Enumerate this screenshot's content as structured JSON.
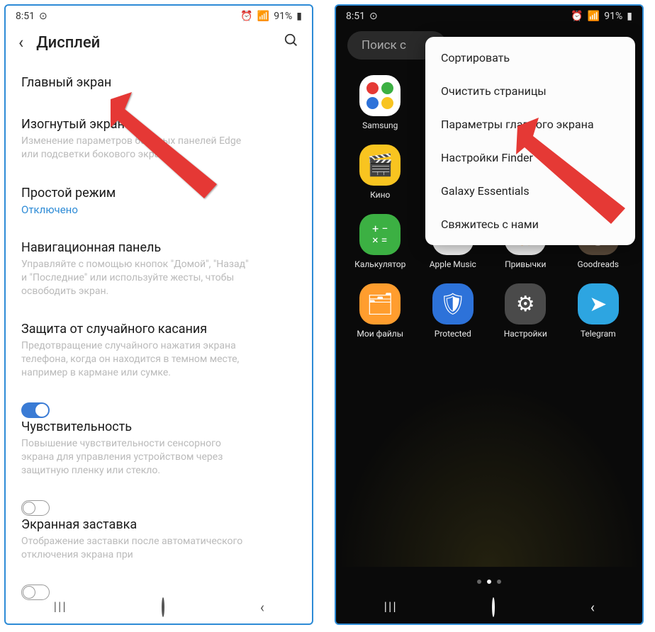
{
  "left": {
    "status": {
      "time": "8:51",
      "battery": "91%"
    },
    "header": {
      "title": "Дисплей"
    },
    "items": [
      {
        "title": "Главный экран",
        "desc": "",
        "control": "none"
      },
      {
        "title": "Изогнутый экран",
        "desc": "Изменение параметров боковых панелей Edge или подсветки бокового экрана",
        "control": "none"
      },
      {
        "title": "Простой режим",
        "desc": "",
        "status": "Отключено",
        "control": "none"
      },
      {
        "title": "Навигационная панель",
        "desc": "Управляйте с помощью кнопок \"Домой\", \"Назад\" и \"Последние\" или используйте жесты, чтобы освободить экран.",
        "control": "none"
      },
      {
        "title": "Защита от случайного касания",
        "desc": "Предотвращение случайного нажатия экрана телефона, когда он находится в темном месте, например в кармане или сумке.",
        "control": "toggle-on"
      },
      {
        "title": "Чувствительность",
        "desc": "Повышение чувствительности сенсорного экрана для управления устройством через защитную пленку или стекло.",
        "control": "toggle-off"
      },
      {
        "title": "Экранная заставка",
        "desc": "Отображение заставки после автоматического отключения экрана при",
        "control": "toggle-off"
      }
    ]
  },
  "right": {
    "status": {
      "time": "8:51",
      "battery": "91%"
    },
    "search_placeholder": "Поиск с",
    "popup": [
      "Сортировать",
      "Очистить страницы",
      "Параметры главного экрана",
      "Настройки Finder",
      "Galaxy Essentials",
      "Свяжитесь с нами"
    ],
    "apps": [
      {
        "label": "Samsung",
        "bg": "#ffffff",
        "icon": "samsung"
      },
      {
        "label": "",
        "bg": "",
        "icon": ""
      },
      {
        "label": "",
        "bg": "",
        "icon": ""
      },
      {
        "label": "",
        "bg": "",
        "icon": ""
      },
      {
        "label": "Кино",
        "bg": "#f8c420",
        "icon": "🎬"
      },
      {
        "label": "",
        "bg": "",
        "icon": ""
      },
      {
        "label": "",
        "bg": "",
        "icon": ""
      },
      {
        "label": "",
        "bg": "",
        "icon": ""
      },
      {
        "label": "Калькулятор",
        "bg": "#3cb043",
        "icon": "calc"
      },
      {
        "label": "Apple Music",
        "bg": "#f5f5f5",
        "icon": "🎵"
      },
      {
        "label": "Привычки",
        "bg": "#f0f0f0",
        "icon": "🐥"
      },
      {
        "label": "Goodreads",
        "bg": "#5a4a3a",
        "icon": "g"
      },
      {
        "label": "Мои файлы",
        "bg": "#ff9d2e",
        "icon": "📁"
      },
      {
        "label": "Protected",
        "bg": "#2d72d9",
        "icon": "🛡"
      },
      {
        "label": "Настройки",
        "bg": "#4a4a4a",
        "icon": "⚙"
      },
      {
        "label": "Telegram",
        "bg": "#2da5e1",
        "icon": "➤"
      }
    ]
  }
}
